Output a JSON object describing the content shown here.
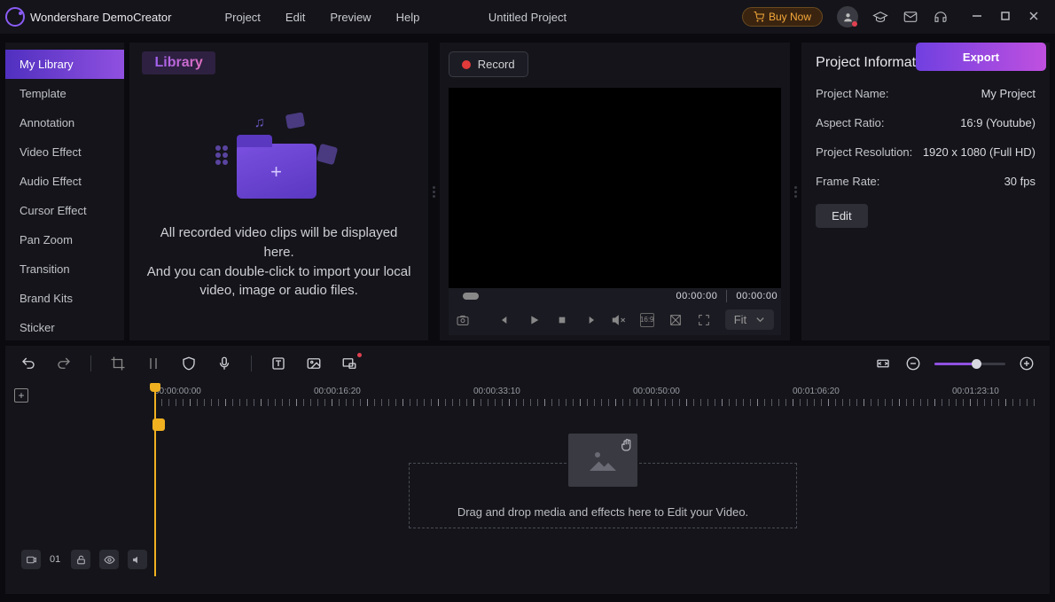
{
  "app_name": "Wondershare DemoCreator",
  "menu": {
    "project": "Project",
    "edit": "Edit",
    "preview": "Preview",
    "help": "Help"
  },
  "project_title": "Untitled Project",
  "buy_now": "Buy Now",
  "sidebar": {
    "items": [
      "My Library",
      "Template",
      "Annotation",
      "Video Effect",
      "Audio Effect",
      "Cursor Effect",
      "Pan Zoom",
      "Transition",
      "Brand Kits",
      "Sticker"
    ]
  },
  "library": {
    "header": "Library",
    "empty_line1": "All recorded video clips will be displayed here.",
    "empty_line2": "And you can double-click to import your local",
    "empty_line3": "video, image or audio files."
  },
  "preview": {
    "record_label": "Record",
    "current_time": "00:00:00",
    "total_time": "00:00:00",
    "fit_label": "Fit"
  },
  "export_label": "Export",
  "project_info": {
    "title": "Project Information",
    "name_label": "Project Name:",
    "name_value": "My Project",
    "aspect_label": "Aspect Ratio:",
    "aspect_value": "16:9 (Youtube)",
    "resolution_label": "Project Resolution:",
    "resolution_value": "1920 x 1080 (Full HD)",
    "framerate_label": "Frame Rate:",
    "framerate_value": "30 fps",
    "edit_button": "Edit"
  },
  "timeline": {
    "ruler": [
      "00:00:00:00",
      "00:00:16:20",
      "00:00:33:10",
      "00:00:50:00",
      "00:01:06:20",
      "00:01:23:10"
    ],
    "dropzone_text": "Drag and drop media and effects here to Edit your Video.",
    "track_number": "01"
  }
}
